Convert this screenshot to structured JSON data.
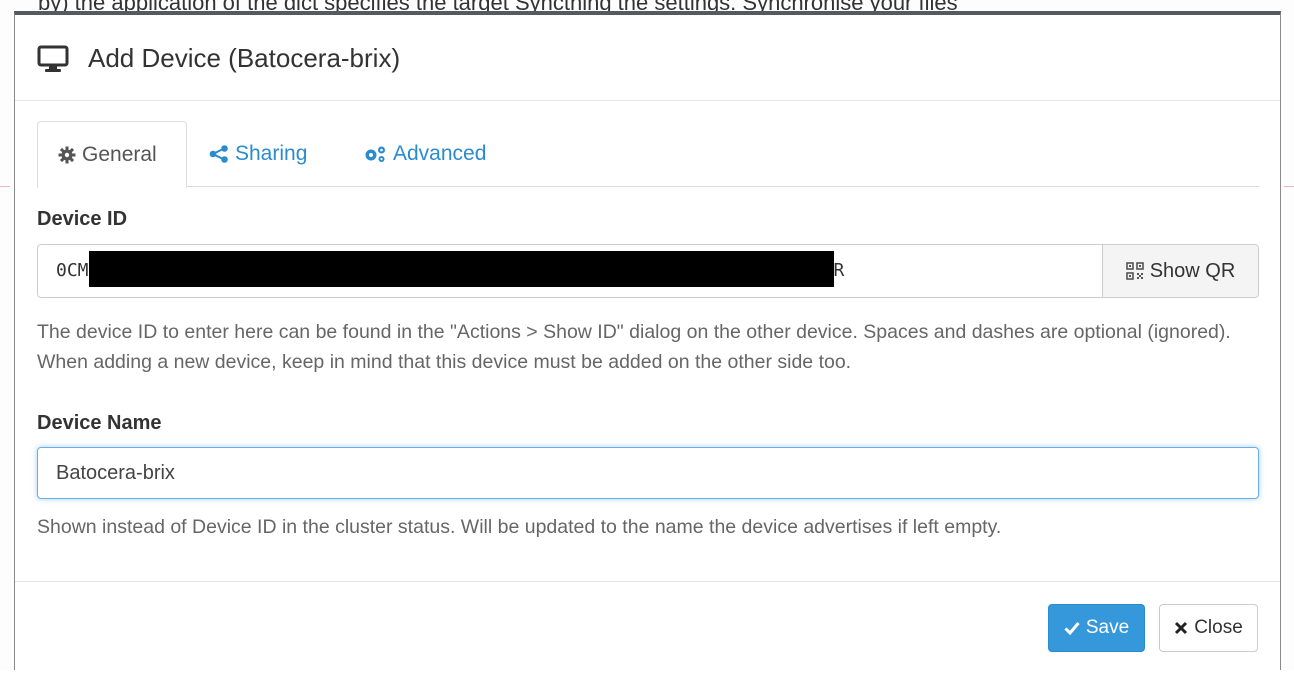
{
  "background": {
    "top_text": "by) the application of the dict specifies the target Syncthing the settings. Synchronise your files"
  },
  "modal": {
    "title": "Add Device (Batocera-brix)",
    "title_icon": "desktop-monitor-icon"
  },
  "tabs": [
    {
      "label": "General",
      "icon": "gear-icon",
      "active": true
    },
    {
      "label": "Sharing",
      "icon": "share-icon",
      "active": false
    },
    {
      "label": "Advanced",
      "icon": "gears-icon",
      "active": false
    }
  ],
  "device_id": {
    "label": "Device ID",
    "value_prefix": "0CM",
    "value_suffix": "R",
    "redacted": true,
    "show_qr_label": "Show QR",
    "show_qr_icon": "qrcode-icon",
    "help": "The device ID to enter here can be found in the \"Actions > Show ID\" dialog on the other device. Spaces and dashes are optional (ignored). When adding a new device, keep in mind that this device must be added on the other side too."
  },
  "device_name": {
    "label": "Device Name",
    "value": "Batocera-brix",
    "help": "Shown instead of Device ID in the cluster status. Will be updated to the name the device advertises if left empty."
  },
  "footer": {
    "save_label": "Save",
    "save_icon": "check-icon",
    "close_label": "Close",
    "close_icon": "close-icon"
  },
  "colors": {
    "accent": "#3498db",
    "link": "#2a8ccf",
    "focus": "#66afe9"
  }
}
